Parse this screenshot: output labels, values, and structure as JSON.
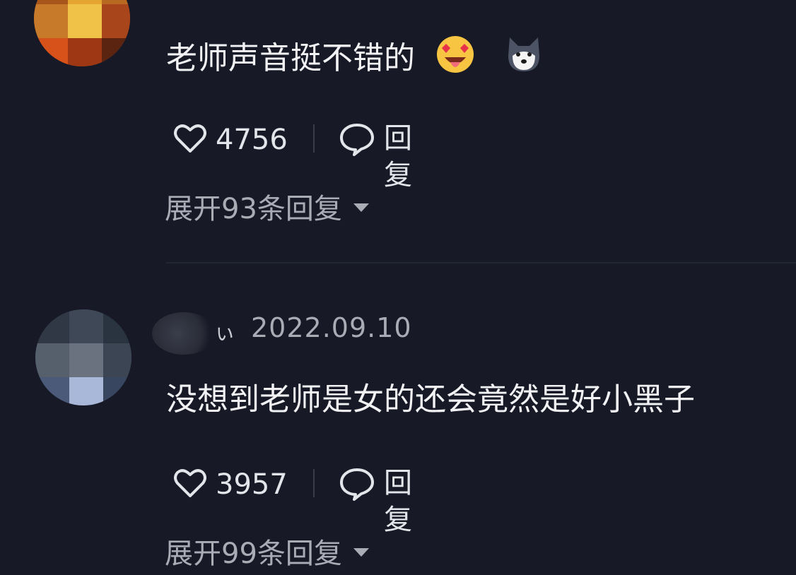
{
  "comments": [
    {
      "content": "老师声音挺不错的",
      "emojis": [
        "star-struck-emoji",
        "husky-dog-emoji"
      ],
      "likes": "4756",
      "reply_label": "回复",
      "expand_label": "展开93条回复"
    },
    {
      "username_visible": "ぃ",
      "date": "2022.09.10",
      "content": "没想到老师是女的还会竟然是好小黑子",
      "likes": "3957",
      "reply_label": "回复",
      "expand_label": "展开99条回复"
    }
  ],
  "colors": {
    "background": "#171a26",
    "text_primary": "#f2f2f4",
    "text_secondary": "#a9abb5"
  }
}
